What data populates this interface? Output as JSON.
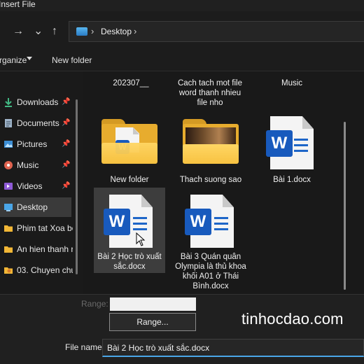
{
  "window": {
    "title": "Insert File"
  },
  "address": {
    "crumb": "Desktop",
    "separator": "›"
  },
  "nav": {
    "forward": "→",
    "down": "⌄",
    "up": "↑"
  },
  "toolbar": {
    "organize_label": "rganize",
    "new_folder_label": "New folder"
  },
  "sidebar": {
    "items": [
      {
        "label": "Downloads",
        "icon": "download-icon",
        "pinned": true
      },
      {
        "label": "Documents",
        "icon": "documents-icon",
        "pinned": true
      },
      {
        "label": "Pictures",
        "icon": "pictures-icon",
        "pinned": true
      },
      {
        "label": "Music",
        "icon": "music-icon",
        "pinned": true
      },
      {
        "label": "Videos",
        "icon": "videos-icon",
        "pinned": true
      },
      {
        "label": "Desktop",
        "icon": "desktop-icon",
        "pinned": false,
        "selected": true
      },
      {
        "label": "Phim tat Xoa bo",
        "icon": "folder-icon",
        "pinned": false
      },
      {
        "label": "An hien thanh ri",
        "icon": "folder-icon",
        "pinned": false
      },
      {
        "label": "03. Chuyen chu",
        "icon": "folder-icon",
        "pinned": false
      }
    ]
  },
  "files": {
    "top_row": [
      "202307__",
      "Cach tach mot file word thanh nhieu file nho",
      "Music"
    ],
    "items": [
      {
        "name": "New folder",
        "type": "folder-document"
      },
      {
        "name": "Thach suong sao",
        "type": "folder-media"
      },
      {
        "name": "Bài 1.docx",
        "type": "word-document"
      },
      {
        "name": "Bài 2 Học trò xuất sắc.docx",
        "type": "word-document",
        "selected": true
      },
      {
        "name": "Bài 3 Quán quân Olympia là thủ khoa khối A01 ở Thái Bình.docx",
        "type": "word-document"
      }
    ]
  },
  "bottom": {
    "range_label": "Range:",
    "range_button": "Range...",
    "filename_label": "File name:",
    "filename_value": "Bài 2 Học trò xuất sắc.docx",
    "watermark": "tinhocdao.com"
  },
  "colors": {
    "accent": "#4aa6e8",
    "word_blue": "#185abd",
    "folder_yellow": "#f7c241"
  }
}
